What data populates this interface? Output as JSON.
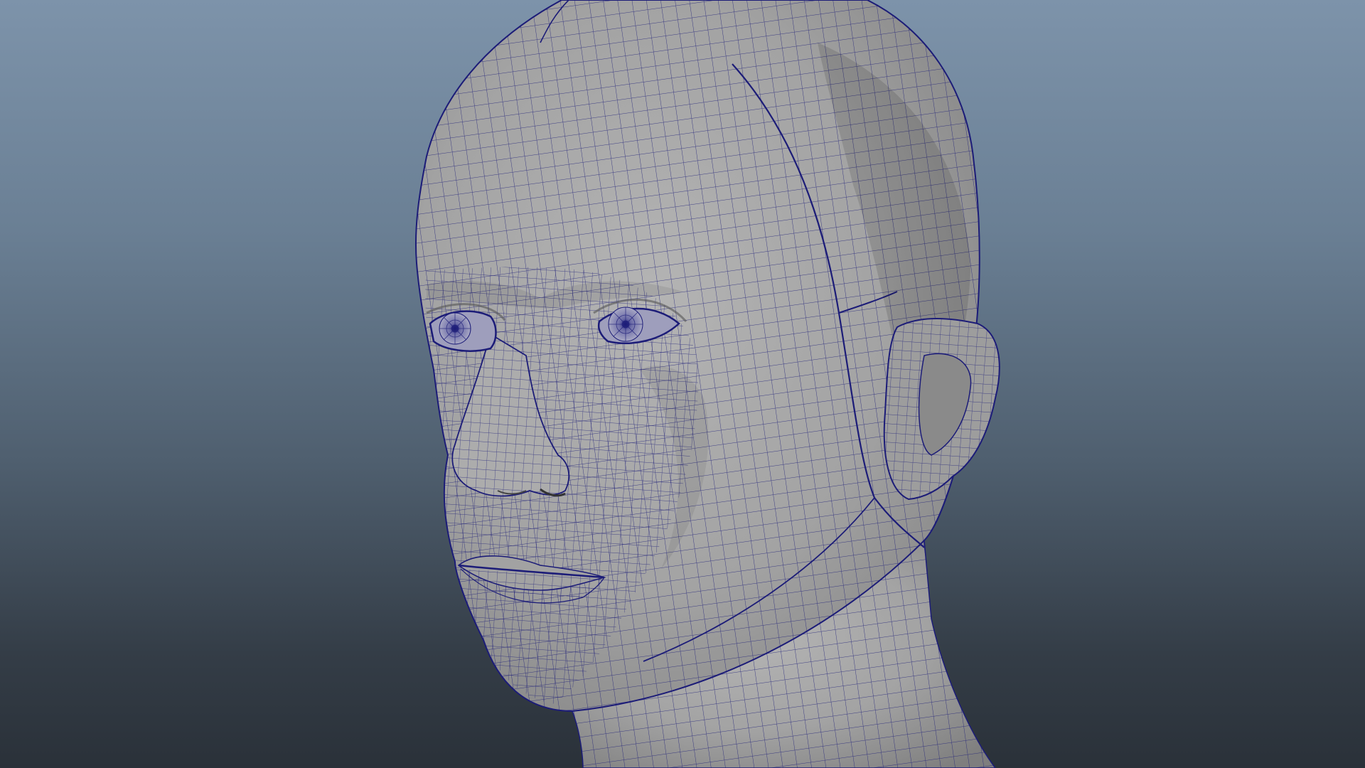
{
  "viewport": {
    "background_top": "#7d93aa",
    "background_bottom": "#2a3139"
  },
  "model": {
    "shading": "wireframe-on-shaded",
    "surface_color": "#a6a6a6",
    "wire_color": "#1c1c78",
    "icon": "head-mesh-icon"
  }
}
